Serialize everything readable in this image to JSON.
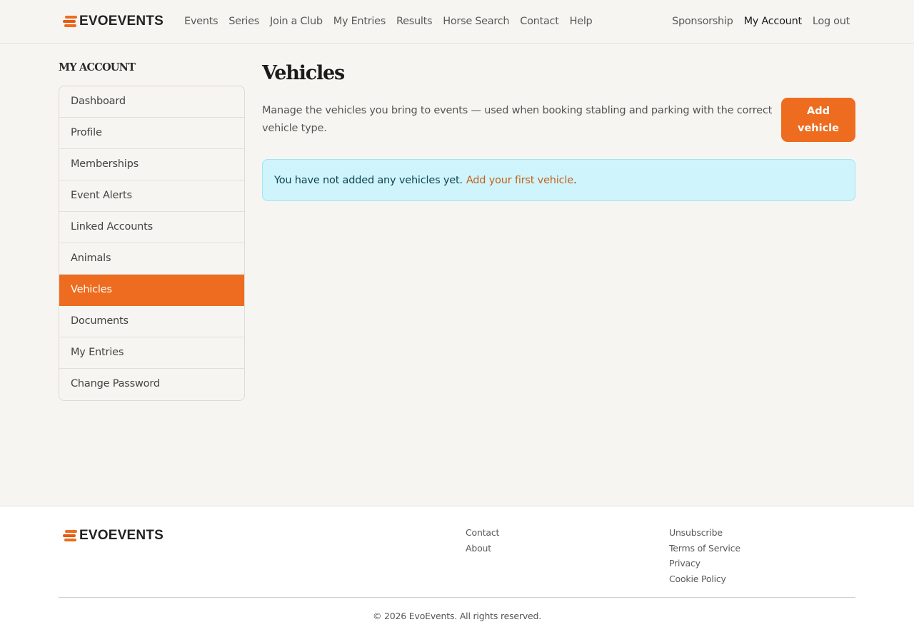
{
  "brand": {
    "name": "EVOEVENTS",
    "accent": "#ee6c1f"
  },
  "nav": {
    "items": [
      "Events",
      "Series",
      "Join a Club",
      "My Entries",
      "Results",
      "Horse Search",
      "Contact",
      "Help"
    ],
    "right": [
      "Sponsorship",
      "My Account",
      "Log out"
    ],
    "active": "My Account"
  },
  "sidebar": {
    "title": "MY ACCOUNT",
    "items": [
      {
        "label": "Dashboard"
      },
      {
        "label": "Profile"
      },
      {
        "label": "Memberships"
      },
      {
        "label": "Event Alerts"
      },
      {
        "label": "Linked Accounts"
      },
      {
        "label": "Animals"
      },
      {
        "label": "Vehicles",
        "active": true
      },
      {
        "label": "Documents"
      },
      {
        "label": "My Entries"
      },
      {
        "label": "Change Password"
      }
    ]
  },
  "main": {
    "title": "Vehicles",
    "intro": "Manage the vehicles you bring to events — used when booking stabling and parking with the correct vehicle type.",
    "add_button": "Add vehicle",
    "notice": {
      "text": "You have not added any vehicles yet.",
      "link": "Add your first vehicle",
      "suffix": "."
    }
  },
  "footer": {
    "col1": [
      "Contact",
      "About"
    ],
    "col2": [
      "Unsubscribe",
      "Terms of Service",
      "Privacy",
      "Cookie Policy"
    ],
    "copyright": "© 2026 EvoEvents. All rights reserved."
  }
}
